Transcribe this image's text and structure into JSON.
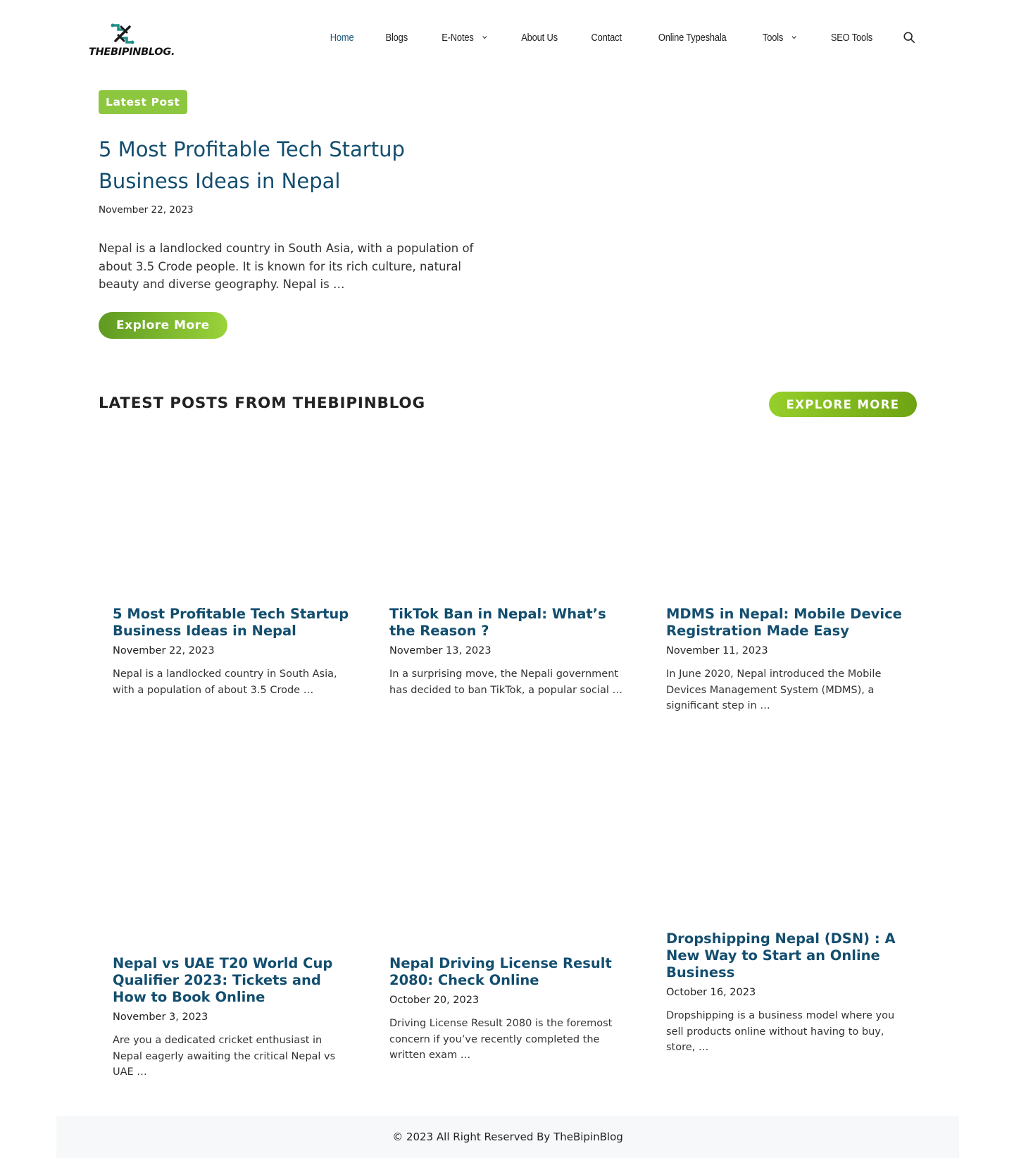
{
  "logo": {
    "text": "THEBIPINBLOG.",
    "icon": "logo-mark-icon"
  },
  "nav": {
    "items": [
      {
        "label": "Home",
        "active": true,
        "dropdown": false
      },
      {
        "label": "Blogs",
        "active": false,
        "dropdown": false
      },
      {
        "label": "E-Notes",
        "active": false,
        "dropdown": true
      },
      {
        "label": "About Us",
        "active": false,
        "dropdown": false
      },
      {
        "label": "Contact",
        "active": false,
        "dropdown": false
      },
      {
        "label": "Online Typeshala",
        "active": false,
        "dropdown": false
      },
      {
        "label": "Tools",
        "active": false,
        "dropdown": true
      },
      {
        "label": "SEO Tools",
        "active": false,
        "dropdown": false
      }
    ],
    "search_icon": "search-icon"
  },
  "hero": {
    "badge": "Latest Post",
    "title": "5 Most Profitable Tech Startup Business Ideas in Nepal",
    "date": "November 22, 2023",
    "excerpt": "Nepal is a landlocked country in South Asia, with a population of about 3.5 Crode people. It is known for its rich culture, natural beauty  and diverse geography. Nepal is …",
    "button": "Explore More"
  },
  "latest": {
    "title": "LATEST POSTS FROM THEBIPINBLOG",
    "button": "EXPLORE MORE",
    "posts": [
      {
        "title": "5 Most Profitable Tech Startup Business Ideas in Nepal",
        "date": "November 22, 2023",
        "excerpt": "Nepal is a landlocked country in South Asia, with a population of about 3.5 Crode …"
      },
      {
        "title": "TikTok Ban in Nepal: What’s the Reason ?",
        "date": "November 13, 2023",
        "excerpt": "In a surprising move, the Nepali government has decided to ban TikTok, a popular social …"
      },
      {
        "title": "MDMS in Nepal: Mobile Device Registration Made Easy",
        "date": "November 11, 2023",
        "excerpt": "In June 2020, Nepal introduced the Mobile Devices Management System (MDMS), a significant step in …"
      },
      {
        "title": "Nepal vs UAE T20 World Cup Qualifier 2023: Tickets and How to Book Online",
        "date": "November 3, 2023",
        "excerpt": "Are you a dedicated cricket enthusiast in Nepal eagerly awaiting the critical Nepal vs UAE …"
      },
      {
        "title": "Nepal Driving License Result 2080: Check Online",
        "date": "October 20, 2023",
        "excerpt": "Driving License Result 2080 is the foremost concern if you’ve recently completed the written exam …"
      },
      {
        "title": "Dropshipping Nepal (DSN) : A New Way to Start an Online Business",
        "date": "October 16, 2023",
        "excerpt": "Dropshipping is a business model where you sell products online without having to buy, store, …"
      }
    ]
  },
  "footer": {
    "text": "© 2023 All Right Reserved By TheBipinBlog"
  },
  "colors": {
    "link": "#134e6f",
    "accent": "#8dc63f",
    "footer_bg": "#f7f8f9"
  }
}
